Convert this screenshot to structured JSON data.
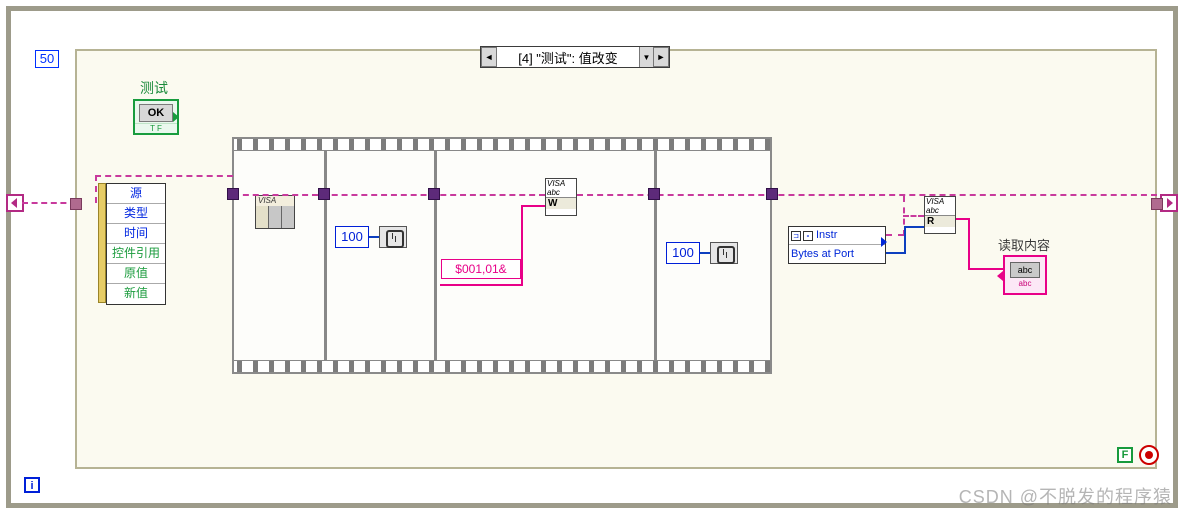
{
  "case_selector": {
    "label": "[4] \"测试\": 值改变"
  },
  "loop": {
    "count": "50",
    "i_label": "i",
    "f_label": "F"
  },
  "test_control": {
    "label": "测试",
    "button_text": "OK",
    "tf": "T F"
  },
  "unbundle": {
    "items": [
      {
        "label": "源",
        "cls": ""
      },
      {
        "label": "类型",
        "cls": ""
      },
      {
        "label": "时间",
        "cls": ""
      },
      {
        "label": "控件引用",
        "cls": "green"
      },
      {
        "label": "原值",
        "cls": "green"
      },
      {
        "label": "新值",
        "cls": "green"
      }
    ]
  },
  "visa": {
    "tag": "VISA",
    "abc": "abc",
    "w": "W",
    "r": "R"
  },
  "wait1_value": "100",
  "wait2_value": "100",
  "write_string": "$001,01&",
  "property_node": {
    "class": "Instr",
    "prop": "Bytes at Port"
  },
  "read_indicator": {
    "label": "读取内容",
    "box": "abc",
    "sub": "abc"
  },
  "watermark": "CSDN @不脱发的程序猿"
}
